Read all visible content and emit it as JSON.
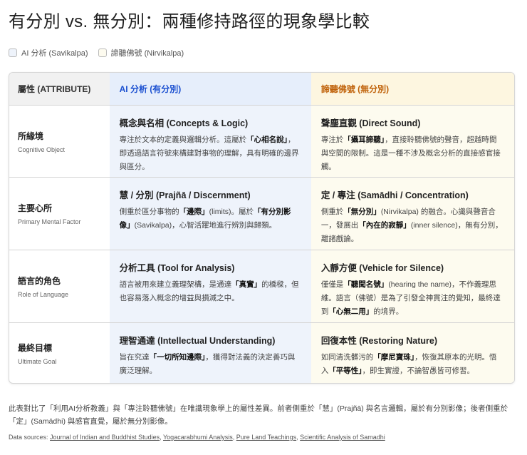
{
  "title": "有分別 vs. 無分別：兩種修持路徑的現象學比較",
  "legend": [
    {
      "label": "AI 分析 (Savikalpa)",
      "color": "#eef3fb"
    },
    {
      "label": "諦聽佛號 (Nirvikalpa)",
      "color": "#fdfbef"
    }
  ],
  "header": {
    "attr": "屬性 (ATTRIBUTE)",
    "ai": "AI 分析 (有分別)",
    "chant": "諦聽佛號 (無分別)"
  },
  "colors": {
    "ai_accent": "#1a4fd0",
    "chant_accent": "#c0620a"
  },
  "rows": [
    {
      "attr": "所緣境",
      "attr_en": "Cognitive Object",
      "ai": {
        "title": "概念與名相 (Concepts & Logic)",
        "desc": [
          {
            "t": "專注於文本的定義與邏輯分析。這屬於"
          },
          {
            "t": "「心相名說」",
            "b": true
          },
          {
            "t": "，即透過語言符號來構建對事物的理解，具有明確的邊界與區分。"
          }
        ]
      },
      "chant": {
        "title": "聲塵直觀 (Direct Sound)",
        "desc": [
          {
            "t": "專注於"
          },
          {
            "t": "「攝耳諦聽」",
            "b": true
          },
          {
            "t": "，直接聆聽佛號的聲音，超越時間與空間的限制。這是一種不涉及概念分析的直接感官接觸。"
          }
        ]
      }
    },
    {
      "attr": "主要心所",
      "attr_en": "Primary Mental Factor",
      "ai": {
        "title": "慧 / 分別 (Prajñā / Discernment)",
        "desc": [
          {
            "t": "側重於區分事物的"
          },
          {
            "t": "「邊際」",
            "b": true
          },
          {
            "t": "(limits)。屬於"
          },
          {
            "t": "「有分別影像」",
            "b": true
          },
          {
            "t": "(Savikalpa)，心智活躍地進行辨別與歸類。"
          }
        ]
      },
      "chant": {
        "title": "定 / 專注 (Samādhi / Concentration)",
        "desc": [
          {
            "t": "側重於"
          },
          {
            "t": "「無分別」",
            "b": true
          },
          {
            "t": "(Nirvikalpa) 的融合。心識與聲音合一，發展出"
          },
          {
            "t": "「內在的寂靜」",
            "b": true
          },
          {
            "t": "(inner silence)，無有分別，離諸戲論。"
          }
        ]
      }
    },
    {
      "attr": "語言的角色",
      "attr_en": "Role of Language",
      "ai": {
        "title": "分析工具 (Tool for Analysis)",
        "desc": [
          {
            "t": "語言被用來建立義理架構，是通達"
          },
          {
            "t": "「真實」",
            "b": true
          },
          {
            "t": "的橋樑，但也容易落入概念的增益與損減之中。"
          }
        ]
      },
      "chant": {
        "title": "入靜方便 (Vehicle for Silence)",
        "desc": [
          {
            "t": "僅僅是"
          },
          {
            "t": "「聽聞名號」",
            "b": true
          },
          {
            "t": "(hearing the name)，不作義理思維。語言（佛號）是為了引發全神貫注的覺知，最終達到"
          },
          {
            "t": "「心無二用」",
            "b": true
          },
          {
            "t": "的境界。"
          }
        ]
      }
    },
    {
      "attr": "最終目標",
      "attr_en": "Ultimate Goal",
      "ai": {
        "title": "理智通達 (Intellectual Understanding)",
        "desc": [
          {
            "t": "旨在究達"
          },
          {
            "t": "「一切所知邊際」",
            "b": true
          },
          {
            "t": "，獲得對法義的決定善巧與廣泛理解。"
          }
        ]
      },
      "chant": {
        "title": "回復本性 (Restoring Nature)",
        "desc": [
          {
            "t": "如同清洗髒污的"
          },
          {
            "t": "「摩尼寶珠」",
            "b": true
          },
          {
            "t": "，恢復其原本的光明。悟入"
          },
          {
            "t": "「平等性」",
            "b": true
          },
          {
            "t": "，即生實證，不論智愚皆可修習。"
          }
        ]
      }
    }
  ],
  "note": "此表對比了「利用AI分析教義」與「專注聆聽佛號」在唯識現象學上的屬性差異。前者側重於「慧」(Prajñā) 與名言邏輯，屬於有分別影像；後者側重於「定」(Samādhi) 與感官直覺，屬於無分別影像。",
  "sources": {
    "label": "Data sources:",
    "links": [
      "Journal of Indian and Buddhist Studies",
      "Yogacarabhumi Analysis",
      "Pure Land Teachings",
      "Scientific Analysis of Samadhi"
    ]
  }
}
